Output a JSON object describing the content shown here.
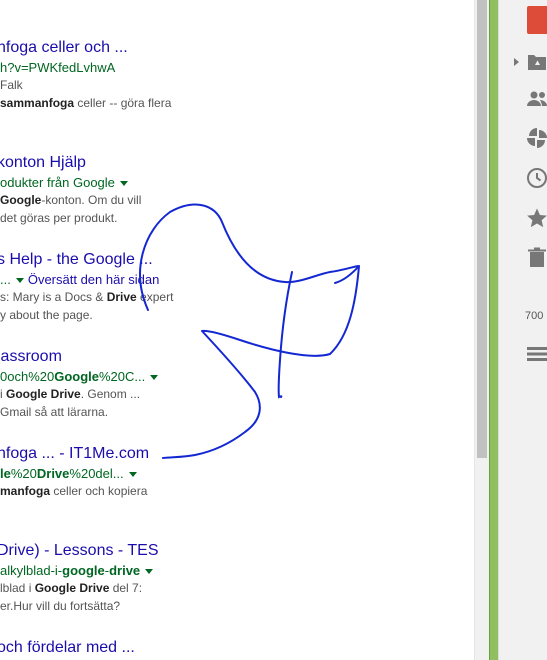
{
  "results": [
    {
      "title": "nfoga celler och ...",
      "url": "h?v=PWKfedLvhwA",
      "snippet": [
        [
          "",
          "Falk"
        ],
        [
          "sammanfoga",
          " celler -- göra flera"
        ]
      ]
    },
    {
      "title": "konton Hjälp",
      "url": "odukter från Google",
      "snippet": [
        [
          "Google",
          "-konton. Om du vill"
        ],
        [
          "",
          "det göras per produkt."
        ]
      ]
    },
    {
      "title": "s Help - the Google ...",
      "url": "...",
      "translate": "Översätt den här sidan",
      "snippet": [
        [
          "",
          "s: Mary is a Docs & "
        ],
        [
          "",
          "y about the page."
        ]
      ]
    },
    {
      "title": "lassroom",
      "url": "0och%20Google%20C...",
      "snippet": [
        [
          "",
          "i Google Drive. Genom ..."
        ],
        [
          "",
          "Gmail så att lärarna."
        ]
      ]
    },
    {
      "title": "nfoga ... - IT1Me.com",
      "url": "le%20Drive%20del...",
      "snippet": [
        [
          "manfoga",
          " celler och kopiera"
        ]
      ]
    },
    {
      "title": "Drive) - Lessons - TES",
      "url": "alkylblad-i-google-drive",
      "snippet": [
        [
          "",
          "lblad i Google Drive del 7:"
        ],
        [
          "",
          "er.Hur vill du fortsätta?"
        ]
      ]
    },
    {
      "title": "och fördelar med ...",
      "url": "",
      "snippet": []
    }
  ],
  "drive": {
    "storage_label": "700",
    "icons": [
      "new-button",
      "my-drive-icon",
      "shared-with-me-icon",
      "google-photos-icon",
      "recent-icon",
      "starred-icon",
      "trash-icon",
      "storage-icon"
    ]
  },
  "colors": {
    "link": "#1a0dab",
    "url": "#006621",
    "snippet": "#545454",
    "accent": "#dd4b39",
    "ink": "#1428d2"
  }
}
